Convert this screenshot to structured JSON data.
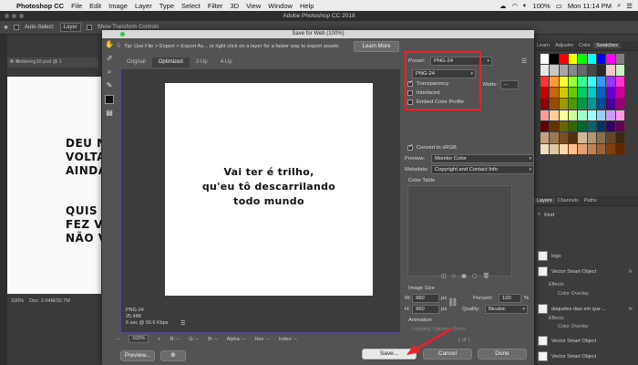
{
  "menubar": {
    "app": "Photoshop CC",
    "items": [
      "File",
      "Edit",
      "Image",
      "Layer",
      "Type",
      "Select",
      "Filter",
      "3D",
      "View",
      "Window",
      "Help"
    ],
    "battery": "100%",
    "clock": "Mon 11:14 PM"
  },
  "ps": {
    "window_title": "Adobe Photoshop CC 2018",
    "options": {
      "auto_select": "Auto-Select:",
      "auto_select_value": "Layer",
      "show_transform": "Show Transform Controls"
    },
    "doc_tab": "lettering10.psd @ 1",
    "canvas_lines": [
      "DEU M",
      "VOLTA",
      "AINDA",
      "",
      "QUIS N",
      "FEZ VO",
      "NÃO V"
    ],
    "zoom": "100%",
    "doc_size": "Doc: 2.64M/32.7M",
    "panel_tabs_top": [
      "Learn",
      "Adjustm",
      "Color",
      "Swatches"
    ],
    "panel_tabs_layers": [
      "Layers",
      "Channels",
      "Paths"
    ],
    "layers_filter": "Kind",
    "layers": [
      {
        "name": "logo",
        "fx": ""
      },
      {
        "name": "Vector Smart Object",
        "fx": "fx"
      },
      {
        "name": "daqueles dias em que ...",
        "fx": "fx"
      },
      {
        "name": "Vector Smart Object",
        "fx": ""
      },
      {
        "name": "Vector Smart Object",
        "fx": ""
      }
    ],
    "layer_effects": [
      "Effects",
      "Color Overlay",
      "Effects",
      "Color Overlay"
    ],
    "swatch_colors": [
      "#ffffff",
      "#000000",
      "#ff0000",
      "#ffff00",
      "#00ff00",
      "#00ffff",
      "#0000ff",
      "#ff00ff",
      "#808080",
      "#e8e8e8",
      "#c8c8c8",
      "#a8a8a8",
      "#888888",
      "#686868",
      "#484848",
      "#282828",
      "#f4c8c8",
      "#c8f4c8",
      "#ff3333",
      "#ff9933",
      "#ffff33",
      "#99ff33",
      "#33ff99",
      "#33ffff",
      "#3399ff",
      "#9933ff",
      "#ff33cc",
      "#cc0000",
      "#cc6600",
      "#cccc00",
      "#66cc00",
      "#00cc66",
      "#00cccc",
      "#0066cc",
      "#6600cc",
      "#cc0099",
      "#990000",
      "#994c00",
      "#999900",
      "#4c9900",
      "#00994c",
      "#009999",
      "#004c99",
      "#4c0099",
      "#990073",
      "#ff9999",
      "#ffcc99",
      "#ffff99",
      "#ccff99",
      "#99ffcc",
      "#99ffff",
      "#99ccff",
      "#cc99ff",
      "#ff99e6",
      "#660000",
      "#663300",
      "#666600",
      "#336600",
      "#006633",
      "#006666",
      "#003366",
      "#330066",
      "#66004d",
      "#c8a07a",
      "#a07850",
      "#785028",
      "#503010",
      "#d4b896",
      "#b49670",
      "#8c6e4c",
      "#644628",
      "#3c2814",
      "#f0e0c0",
      "#e0c8a0",
      "#ffd8b0",
      "#ffc090",
      "#e8a070",
      "#c88050",
      "#a06030",
      "#804010",
      "#602800"
    ]
  },
  "dialog": {
    "title": "Save for Web (100%)",
    "tip": "Tip: Use File > Export > Export As... or right click on a layer for a faster way to export assets",
    "learn_more": "Learn More",
    "tabs": [
      "Original",
      "Optimized",
      "2-Up",
      "4-Up"
    ],
    "active_tab": "Optimized",
    "artwork_lines": [
      "Vai ter é trilho,",
      "qu'eu tô descarrilando",
      "todo mundo"
    ],
    "info": {
      "format": "PNG-24",
      "size": "25.48K",
      "time": "6 sec @ 56.6 Kbps"
    },
    "zoom": "100%",
    "readouts": {
      "r": "R: --",
      "g": "G: --",
      "b": "B: --",
      "alpha": "Alpha: --",
      "hex": "Hex: --",
      "index": "Index: --"
    },
    "preset_label": "Preset:",
    "preset_value": "PNG-24",
    "format_value": "PNG-24",
    "transparency": "Transparency",
    "interlaced": "Interlaced",
    "embed_profile": "Embed Color Profile",
    "matte_label": "Matte:",
    "matte_value": "--",
    "convert_srgb": "Convert to sRGB",
    "preview_label": "Preview:",
    "preview_value": "Monitor Color",
    "metadata_label": "Metadata:",
    "metadata_value": "Copyright and Contact Info",
    "color_table": "Color Table",
    "image_size": "Image Size",
    "w_label": "W:",
    "w_value": "960",
    "h_label": "H:",
    "h_value": "960",
    "px": "px",
    "percent_label": "Percent:",
    "percent_value": "100",
    "percent_unit": "%",
    "quality_label": "Quality:",
    "quality_value": "Bicubic",
    "animation": "Animation",
    "looping_label": "Looping Options:",
    "looping_value": "Once",
    "frame_counter": "1 of 1",
    "preview_button": "Preview...",
    "save_button": "Save...",
    "cancel_button": "Cancel",
    "done_button": "Done",
    "annotation_color": "#e8222a"
  }
}
